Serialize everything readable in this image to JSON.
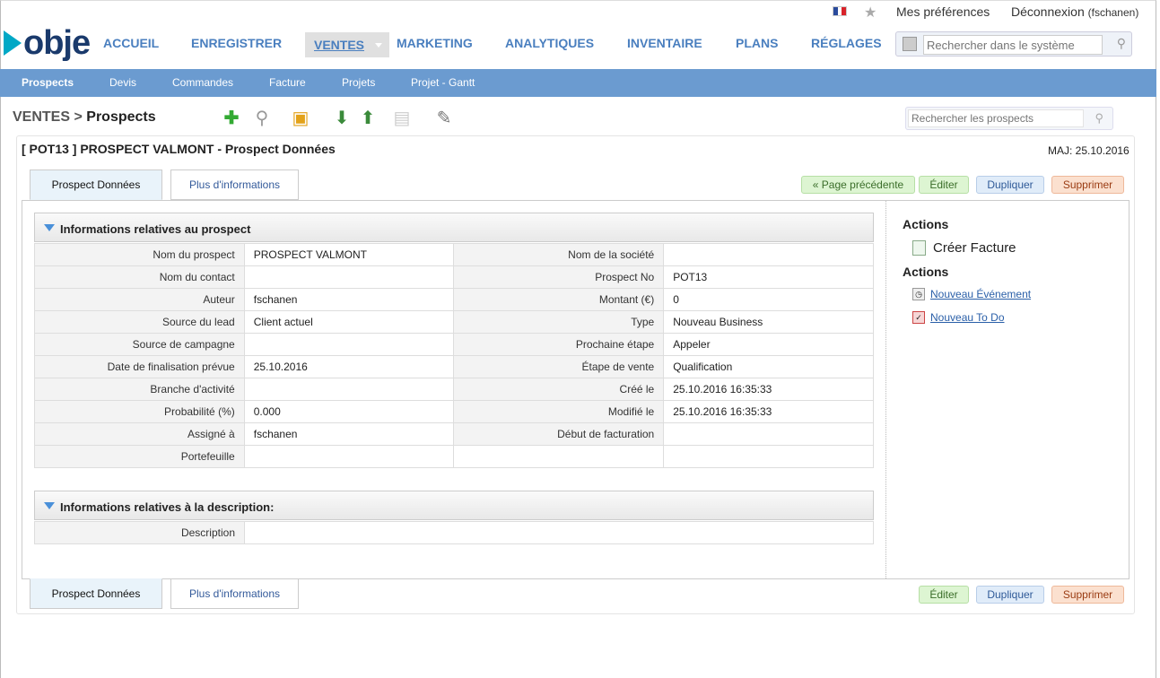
{
  "topbar": {
    "prefs": "Mes préférences",
    "logout": "Déconnexion",
    "user": "(fschanen)"
  },
  "logo": {
    "text": "obje"
  },
  "nav": [
    "ACCUEIL",
    "ENREGISTRER",
    "VENTES",
    "MARKETING",
    "ANALYTIQUES",
    "INVENTAIRE",
    "PLANS",
    "RÉGLAGES"
  ],
  "search": {
    "placeholder": "Rechercher dans le système"
  },
  "subnav": [
    "Prospects",
    "Devis",
    "Commandes",
    "Facture",
    "Projets",
    "Projet - Gantt"
  ],
  "breadcrumb": {
    "module": "VENTES >",
    "page": "Prospects"
  },
  "prospSearch": {
    "placeholder": "Rechercher les prospects"
  },
  "record": {
    "title": "[ POT13 ] PROSPECT VALMONT - Prospect Données",
    "maj": "MAJ: 25.10.2016"
  },
  "tabs": [
    "Prospect Données",
    "Plus d'informations"
  ],
  "buttons": {
    "back": "« Page précédente",
    "edit": "Éditer",
    "duplicate": "Dupliquer",
    "delete": "Supprimer"
  },
  "section1": {
    "title": "Informations relatives au prospect",
    "rows": [
      [
        "Nom du prospect",
        "PROSPECT VALMONT",
        "Nom de la société",
        ""
      ],
      [
        "Nom du contact",
        "",
        "Prospect No",
        "POT13"
      ],
      [
        "Auteur",
        "fschanen",
        "Montant (€)",
        "0"
      ],
      [
        "Source du lead",
        "Client actuel",
        "Type",
        "Nouveau Business"
      ],
      [
        "Source de campagne",
        "",
        "Prochaine étape",
        "Appeler"
      ],
      [
        "Date de finalisation prévue",
        "25.10.2016",
        "Étape de vente",
        "Qualification"
      ],
      [
        "Branche d'activité",
        "",
        "Créé le",
        "25.10.2016 16:35:33"
      ],
      [
        "Probabilité (%)",
        "0.000",
        "Modifié le",
        "25.10.2016 16:35:33"
      ],
      [
        "Assigné à",
        " fschanen",
        "Début de facturation",
        ""
      ],
      [
        "Portefeuille",
        "",
        "",
        ""
      ]
    ]
  },
  "section2": {
    "title": "Informations relatives à la description:",
    "rows": [
      [
        "Description",
        ""
      ]
    ]
  },
  "sidebar": {
    "actions1": "Actions",
    "createInvoice": "Créer Facture",
    "actions2": "Actions",
    "newEvent": "Nouveau Événement",
    "newTodo": "Nouveau To Do"
  }
}
